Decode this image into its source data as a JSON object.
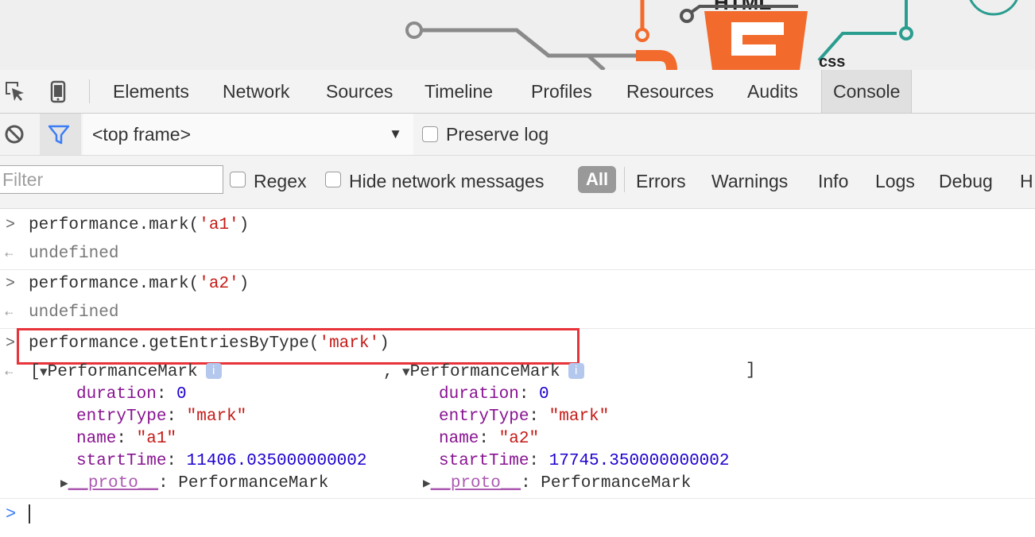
{
  "page_strip": {
    "html_logo_text": "HTML",
    "css_logo_text": "css"
  },
  "tabs": [
    {
      "label": "Elements",
      "active": false
    },
    {
      "label": "Network",
      "active": false
    },
    {
      "label": "Sources",
      "active": false
    },
    {
      "label": "Timeline",
      "active": false
    },
    {
      "label": "Profiles",
      "active": false
    },
    {
      "label": "Resources",
      "active": false
    },
    {
      "label": "Audits",
      "active": false
    },
    {
      "label": "Console",
      "active": true
    }
  ],
  "toolbar": {
    "inspect_icon": "inspect-element-icon",
    "device_icon": "device-mode-icon"
  },
  "frame_bar": {
    "clear_icon": "clear-console-icon",
    "filter_icon": "filter-icon",
    "frame_label": "<top frame>",
    "preserve_log_label": "Preserve log",
    "preserve_log_checked": false
  },
  "filter_bar": {
    "placeholder": "Filter",
    "regex_label": "Regex",
    "regex_checked": false,
    "hide_network_label": "Hide network messages",
    "hide_network_checked": false,
    "levels": [
      "All",
      "Errors",
      "Warnings",
      "Info",
      "Logs",
      "Debug",
      "H"
    ],
    "active_level": "All"
  },
  "console": {
    "lines": [
      {
        "type": "input",
        "prefix": "performance.mark(",
        "arg": "'a1'",
        "suffix": ")"
      },
      {
        "type": "output",
        "text": "undefined"
      },
      {
        "type": "input",
        "prefix": "performance.mark(",
        "arg": "'a2'",
        "suffix": ")"
      },
      {
        "type": "output",
        "text": "undefined"
      },
      {
        "type": "input",
        "prefix": "performance.getEntriesByType(",
        "arg": "'mark'",
        "suffix": ")"
      }
    ],
    "result": {
      "open_bracket": "[",
      "comma": ",",
      "close_bracket": "]",
      "info_badge": "i",
      "objects": [
        {
          "class_name": "PerformanceMark",
          "duration_key": "duration",
          "duration": "0",
          "entryType_key": "entryType",
          "entryType": "\"mark\"",
          "name_key": "name",
          "name": "\"a1\"",
          "startTime_key": "startTime",
          "startTime": "11406.035000000002",
          "proto_key": "__proto__",
          "proto": "PerformanceMark"
        },
        {
          "class_name": "PerformanceMark",
          "duration_key": "duration",
          "duration": "0",
          "entryType_key": "entryType",
          "entryType": "\"mark\"",
          "name_key": "name",
          "name": "\"a2\"",
          "startTime_key": "startTime",
          "startTime": "17745.350000000002",
          "proto_key": "__proto__",
          "proto": "PerformanceMark"
        }
      ]
    },
    "colors": {
      "highlight": "#e8333a",
      "string": "#c41a16",
      "number": "#1c00cf",
      "key": "#881391",
      "prompt": "#3c7df6"
    }
  }
}
